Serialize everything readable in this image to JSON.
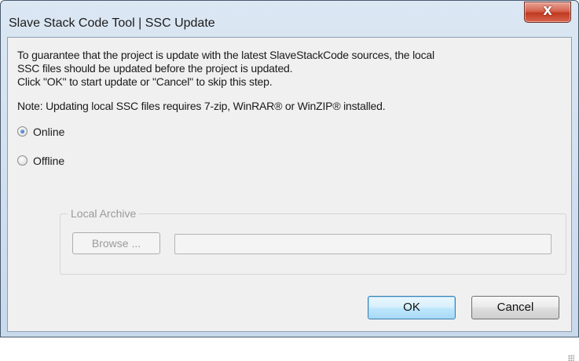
{
  "window": {
    "title": "Slave Stack Code Tool | SSC Update",
    "close_glyph": "X"
  },
  "message": {
    "line1": "To guarantee that the project is update with the latest SlaveStackCode sources, the local",
    "line2": "SSC files should be updated before the project is updated.",
    "line3": "Click \"OK\" to start update or \"Cancel\" to skip this step.",
    "note": "Note: Updating local SSC files requires 7-zip, WinRAR® or  WinZIP® installed."
  },
  "options": {
    "online_label": "Online",
    "offline_label": "Offline",
    "selected": "Online"
  },
  "local_archive": {
    "legend": "Local Archive",
    "browse_label": "Browse ...",
    "path_value": ""
  },
  "buttons": {
    "ok_label": "OK",
    "cancel_label": "Cancel"
  }
}
